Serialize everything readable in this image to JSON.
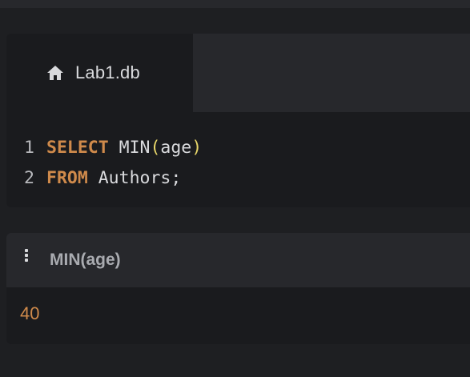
{
  "tabs": [
    {
      "label": "Lab1.db",
      "icon": "home-icon"
    }
  ],
  "editor": {
    "lines": [
      {
        "number": "1",
        "keyword": "SELECT",
        "func": "MIN",
        "open": "(",
        "arg": "age",
        "close": ")"
      },
      {
        "number": "2",
        "keyword": "FROM",
        "rest": "Authors;"
      }
    ]
  },
  "results": {
    "menu_icon": "kebab-menu-icon",
    "columns": [
      "MIN(age)"
    ],
    "rows": [
      [
        "40"
      ]
    ]
  },
  "colors": {
    "keyword": "#cf8a4b",
    "paren": "#e8d76a",
    "text": "#d9dadd",
    "value": "#cf8a4b",
    "header_text": "#a9abb0"
  }
}
